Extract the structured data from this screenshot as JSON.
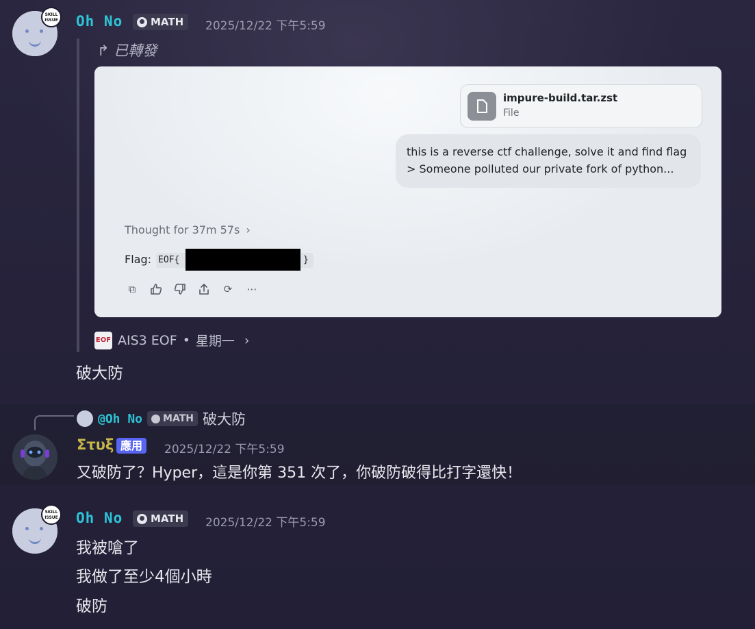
{
  "messages": [
    {
      "author": "Oh No",
      "role": "MATH",
      "badge": "SKILL ISSUE",
      "timestamp": "2025/12/22 下午5:59",
      "forward_label": "已轉發",
      "forwarded_card": {
        "file_name": "impure-build.tar.zst",
        "file_type": "File",
        "prompt_line1": "this is a reverse ctf challenge, solve it and find flag",
        "prompt_line2": "> Someone polluted our private fork of python...",
        "thought": "Thought for 37m 57s",
        "thought_chevron": "›",
        "flag_label": "Flag:",
        "flag_prefix": "EOF{",
        "flag_suffix": "}",
        "actions": [
          "copy-icon",
          "thumbs-up-icon",
          "thumbs-down-icon",
          "share-icon",
          "regenerate-icon",
          "more-icon"
        ]
      },
      "source_logo": "EOF",
      "source": "AIS3 EOF",
      "source_sep": "•",
      "source_day": "星期一",
      "source_chevron": "›",
      "text": "破大防"
    },
    {
      "reply_to_author": "@Oh No",
      "reply_to_role": "MATH",
      "reply_to_text": "破大防",
      "author": "Στυξ",
      "tag": "應用",
      "timestamp": "2025/12/22 下午5:59",
      "text": "又破防了？Hyper，這是你第 351 次了，你破防破得比打字還快！"
    },
    {
      "author": "Oh No",
      "role": "MATH",
      "badge": "SKILL ISSUE",
      "timestamp": "2025/12/22 下午5:59",
      "lines": [
        "我被嗆了",
        "我做了至少4個小時",
        "破防"
      ]
    }
  ],
  "colors": {
    "name": "#2ec4d6",
    "bot_name": "#c8b84a",
    "app_tag": "#5865f2",
    "role_bg": "#3b3a4f"
  }
}
